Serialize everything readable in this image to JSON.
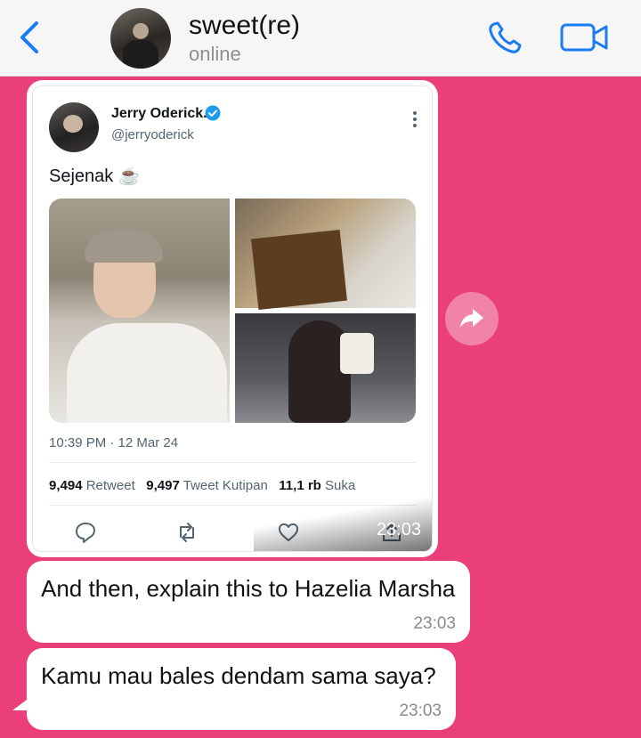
{
  "header": {
    "contact_name": "sweet(re)",
    "status": "online"
  },
  "tweet": {
    "name": "Jerry Oderick.",
    "handle": "@jerryoderick",
    "text": "Sejenak ☕",
    "time": "10:39 PM · 12 Mar 24",
    "stats": {
      "retweets_count": "9,494",
      "retweets_label": "Retweet",
      "quotes_count": "9,497",
      "quotes_label": "Tweet Kutipan",
      "likes_count": "11,1 rb",
      "likes_label": "Suka"
    },
    "message_time": "23:03"
  },
  "messages": [
    {
      "text": "And then, explain this to Hazelia Marsha",
      "time": "23:03"
    },
    {
      "text": "Kamu mau bales dendam sama saya?",
      "time": "23:03"
    }
  ],
  "colors": {
    "chat_background": "#ea3f7a",
    "ios_blue": "#1a7cf5",
    "twitter_blue": "#1d9bf0"
  }
}
